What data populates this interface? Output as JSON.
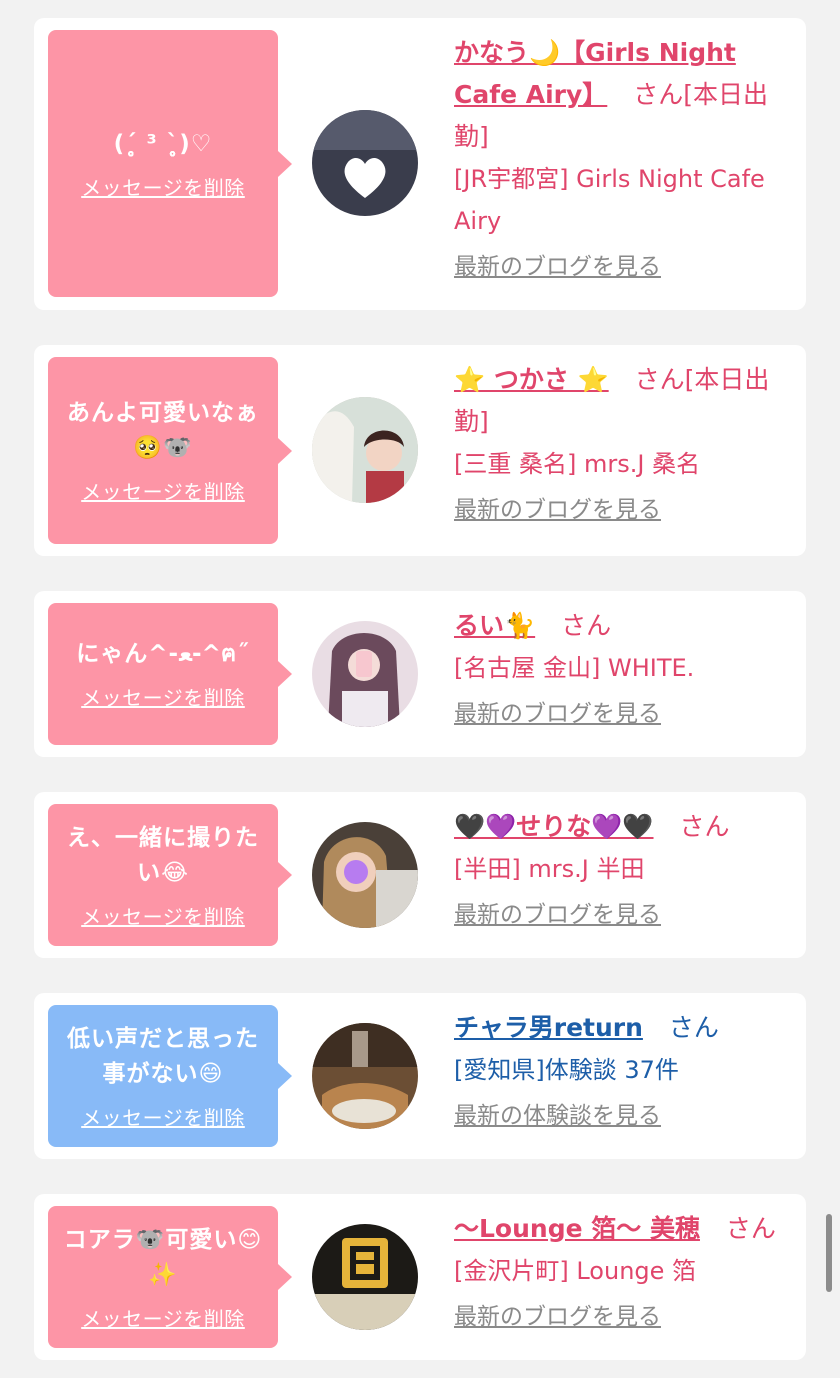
{
  "delete_label": "メッセージを削除",
  "san_label": "さん",
  "cards": [
    {
      "bubble_color": "#fd95a6",
      "message": "(ˊ̥̥̥̥̥ ³ ˋ̥̥̥̥̥)♡",
      "name": "かなう🌙【Girls Night Cafe Airy】",
      "status": "[本日出勤]",
      "shop": "[JR宇都宮] Girls Night Cafe Airy",
      "link": "最新のブログを見る",
      "avatar_icon": "avatar-photo-icon"
    },
    {
      "bubble_color": "#fd95a6",
      "message": "あんよ可愛いなぁ🥺🐨",
      "name": "⭐️ つかさ ⭐️",
      "status": "[本日出勤]",
      "shop": "[三重 桑名] mrs.J 桑名",
      "link": "最新のブログを見る",
      "avatar_icon": "avatar-photo-icon"
    },
    {
      "bubble_color": "#fd95a6",
      "message": "にゃん^-ﻌ-^ฅ˝",
      "name": "るい🐈",
      "status": "",
      "shop": "[名古屋 金山] WHITE.",
      "link": "最新のブログを見る",
      "avatar_icon": "avatar-photo-icon"
    },
    {
      "bubble_color": "#fd95a6",
      "message": "え、一緒に撮りたい😂",
      "name": "🖤💜せりな💜🖤",
      "status": "",
      "shop": "[半田] mrs.J 半田",
      "link": "最新のブログを見る",
      "avatar_icon": "avatar-photo-icon"
    },
    {
      "bubble_color": "#88baf7",
      "message": "低い声だと思った事がない😄",
      "name": "チャラ男return",
      "status": "",
      "shop": "[愛知県]体験談 37件",
      "link": "最新の体験談を見る",
      "avatar_icon": "avatar-photo-icon"
    },
    {
      "bubble_color": "#fd95a6",
      "message": "コアラ🐨可愛い😊✨",
      "name": "〜Lounge 箔〜 美穂",
      "status": "",
      "shop": "[金沢片町] Lounge 箔",
      "link": "最新のブログを見る",
      "avatar_icon": "avatar-photo-icon"
    }
  ]
}
